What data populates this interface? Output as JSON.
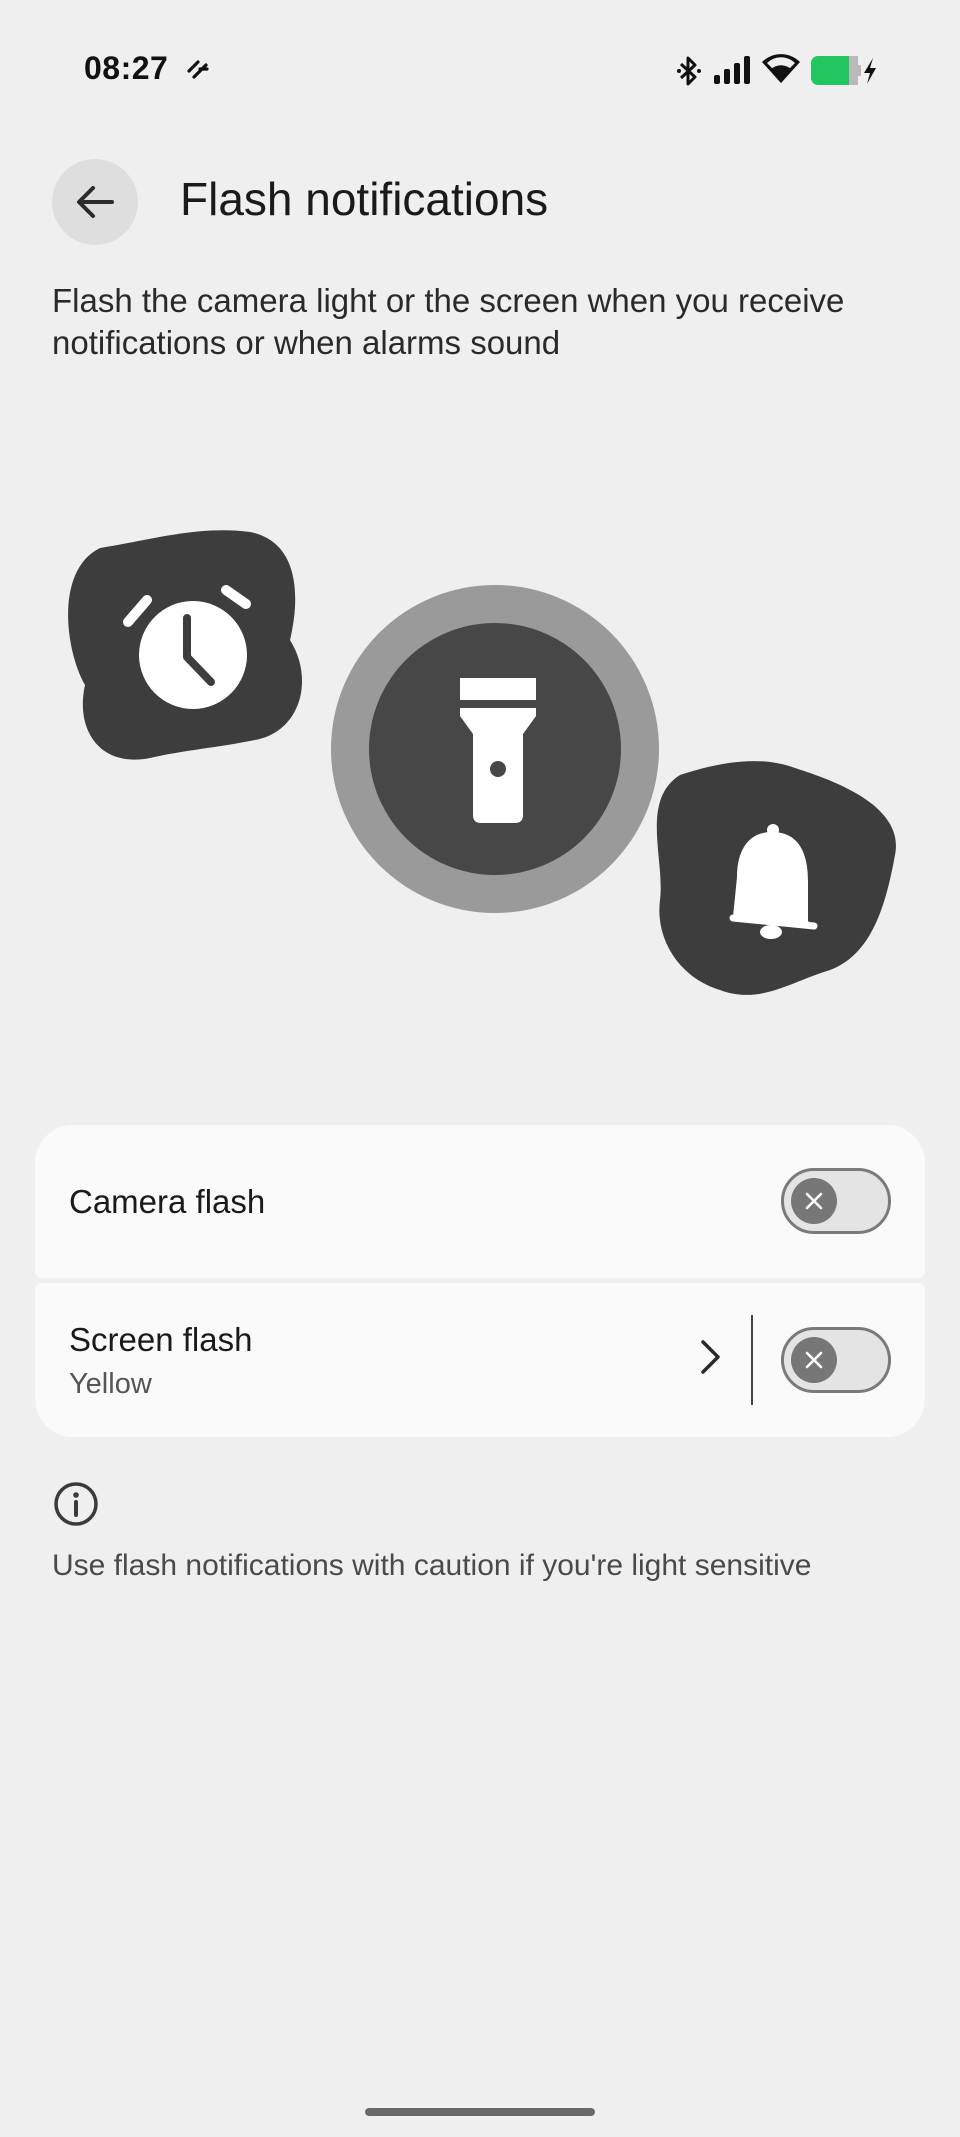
{
  "status_bar": {
    "time": "08:27",
    "icons": [
      "notification-app-icon",
      "bluetooth-icon",
      "cellular-signal-icon",
      "wifi-icon",
      "battery-charging-icon"
    ],
    "battery_color": "#22c55e"
  },
  "header": {
    "back_icon": "arrow-left-icon",
    "title": "Flash notifications"
  },
  "description": "Flash the camera light or the screen when you receive notifications or when alarms sound",
  "illustration": {
    "icons": [
      "alarm-clock-icon",
      "flashlight-icon",
      "bell-icon"
    ]
  },
  "settings": {
    "camera_flash": {
      "label": "Camera flash",
      "enabled": false
    },
    "screen_flash": {
      "label": "Screen flash",
      "value": "Yellow",
      "enabled": false
    }
  },
  "info": {
    "icon": "info-icon",
    "text": "Use flash notifications with caution if you're light sensitive"
  },
  "colors": {
    "background": "#efefef",
    "card": "#fafafa",
    "dark_shape": "#3d3d3d",
    "ring": "#9a9a9a"
  }
}
